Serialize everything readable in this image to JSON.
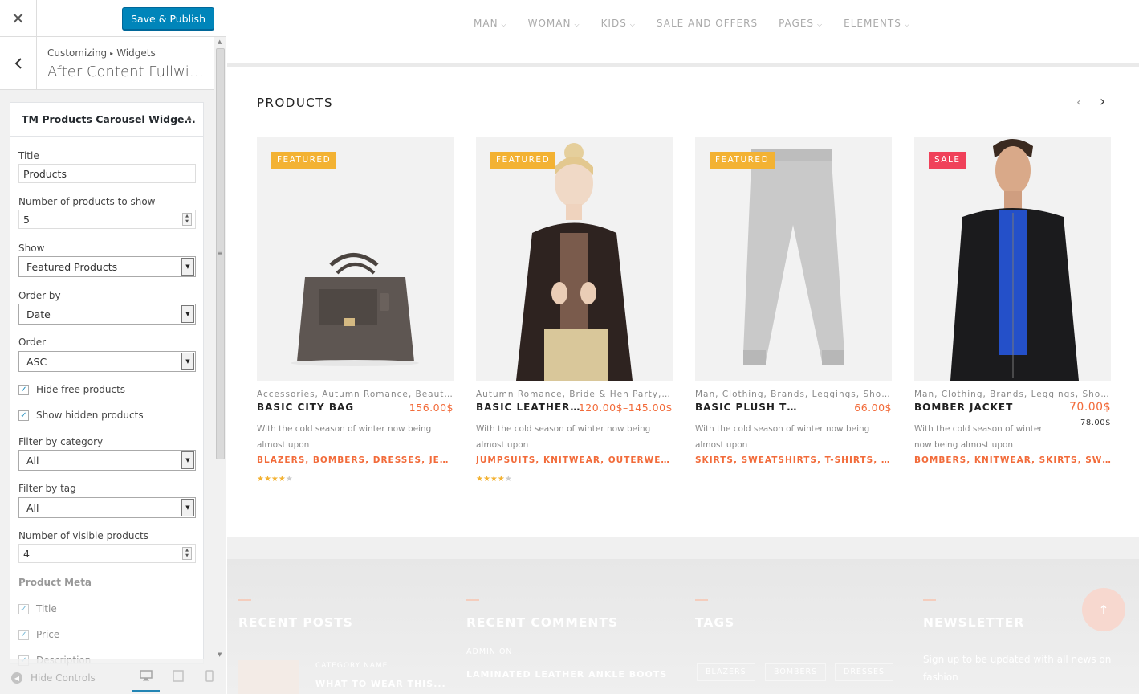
{
  "customizer": {
    "close_icon": "close-icon",
    "publish_label": "Save & Publish",
    "breadcrumb": [
      "Customizing",
      "Widgets"
    ],
    "breadcrumb_sep": "▸",
    "section_title": "After Content Fullwidt...",
    "widget_title": "TM Products Carousel Widge...",
    "fields": {
      "title_label": "Title",
      "title_value": "Products",
      "num_label": "Number of products to show",
      "num_value": "5",
      "show_label": "Show",
      "show_value": "Featured Products",
      "orderby_label": "Order by",
      "orderby_value": "Date",
      "order_label": "Order",
      "order_value": "ASC",
      "hide_free_label": "Hide free products",
      "show_hidden_label": "Show hidden products",
      "cat_label": "Filter by category",
      "cat_value": "All",
      "tag_label": "Filter by tag",
      "tag_value": "All",
      "visible_label": "Number of visible products",
      "visible_value": "4",
      "meta_heading": "Product Meta",
      "meta_title_label": "Title",
      "meta_price_label": "Price",
      "meta_desc_label": "Description"
    },
    "hide_controls_label": "Hide Controls",
    "check_glyph": "✓"
  },
  "preview": {
    "nav": [
      {
        "label": "MAN"
      },
      {
        "label": "WOMAN"
      },
      {
        "label": "KIDS"
      },
      {
        "label": "SALE AND OFFERS"
      },
      {
        "label": "PAGES"
      },
      {
        "label": "ELEMENTS"
      }
    ],
    "nav_chevron": "⌵",
    "products_title": "PRODUCTS",
    "prev_glyph": "‹",
    "next_glyph": "›",
    "products": [
      {
        "badge": "FEATURED",
        "cats": "Accessories, Autumn Romance, Beauty...",
        "name": "BASIC CITY BAG",
        "price": "156.00$",
        "desc": "With the cold season of winter now being almost upon",
        "tags": "BLAZERS, BOMBERS, DRESSES, JEANS",
        "rating": 4
      },
      {
        "badge": "FEATURED",
        "cats": "Autumn Romance, Bride & Hen Party, C...",
        "name": "BASIC LEATHER J...",
        "price": "120.00$–145.00$",
        "desc": "With the cold season of winter now being almost upon",
        "tags": "JUMPSUITS, KNITWEAR, OUTERWEAR, ...",
        "rating": 4
      },
      {
        "badge": "FEATURED",
        "cats": "Man, Clothing, Brands, Leggings, Shoes",
        "name": "BASIC PLUSH TR...",
        "price": "66.00$",
        "desc": "With the cold season of winter now being almost upon",
        "tags": "SKIRTS, SWEATSHIRTS, T-SHIRTS, TOPS...",
        "rating": null
      },
      {
        "badge": "SALE",
        "cats": "Man, Clothing, Brands, Leggings, Shoes",
        "name": "BOMBER JACKET",
        "price": "70.00$",
        "old_price": "78.00$",
        "desc": "With the cold season of winter now being almost upon",
        "tags": "BOMBERS, KNITWEAR, SKIRTS, SWEAT...",
        "rating": null
      }
    ],
    "footer": {
      "recent_posts": "RECENT POSTS",
      "recent_comments": "RECENT COMMENTS",
      "tags": "TAGS",
      "newsletter": "NEWSLETTER",
      "post_category": "CATEGORY NAME",
      "post_title": "WHAT TO WEAR THIS...",
      "comment_author": "ADMIN ON",
      "comment_title": "LAMINATED LEATHER ANKLE BOOTS",
      "tag_chips": [
        "BLAZERS",
        "BOMBERS",
        "DRESSES"
      ],
      "newsletter_text": "Sign up to be updated with all news on fashion"
    },
    "colors": {
      "accent": "#f26b3a",
      "featured": "#f3b233",
      "sale": "#f0415a",
      "publish": "#0085ba"
    }
  }
}
